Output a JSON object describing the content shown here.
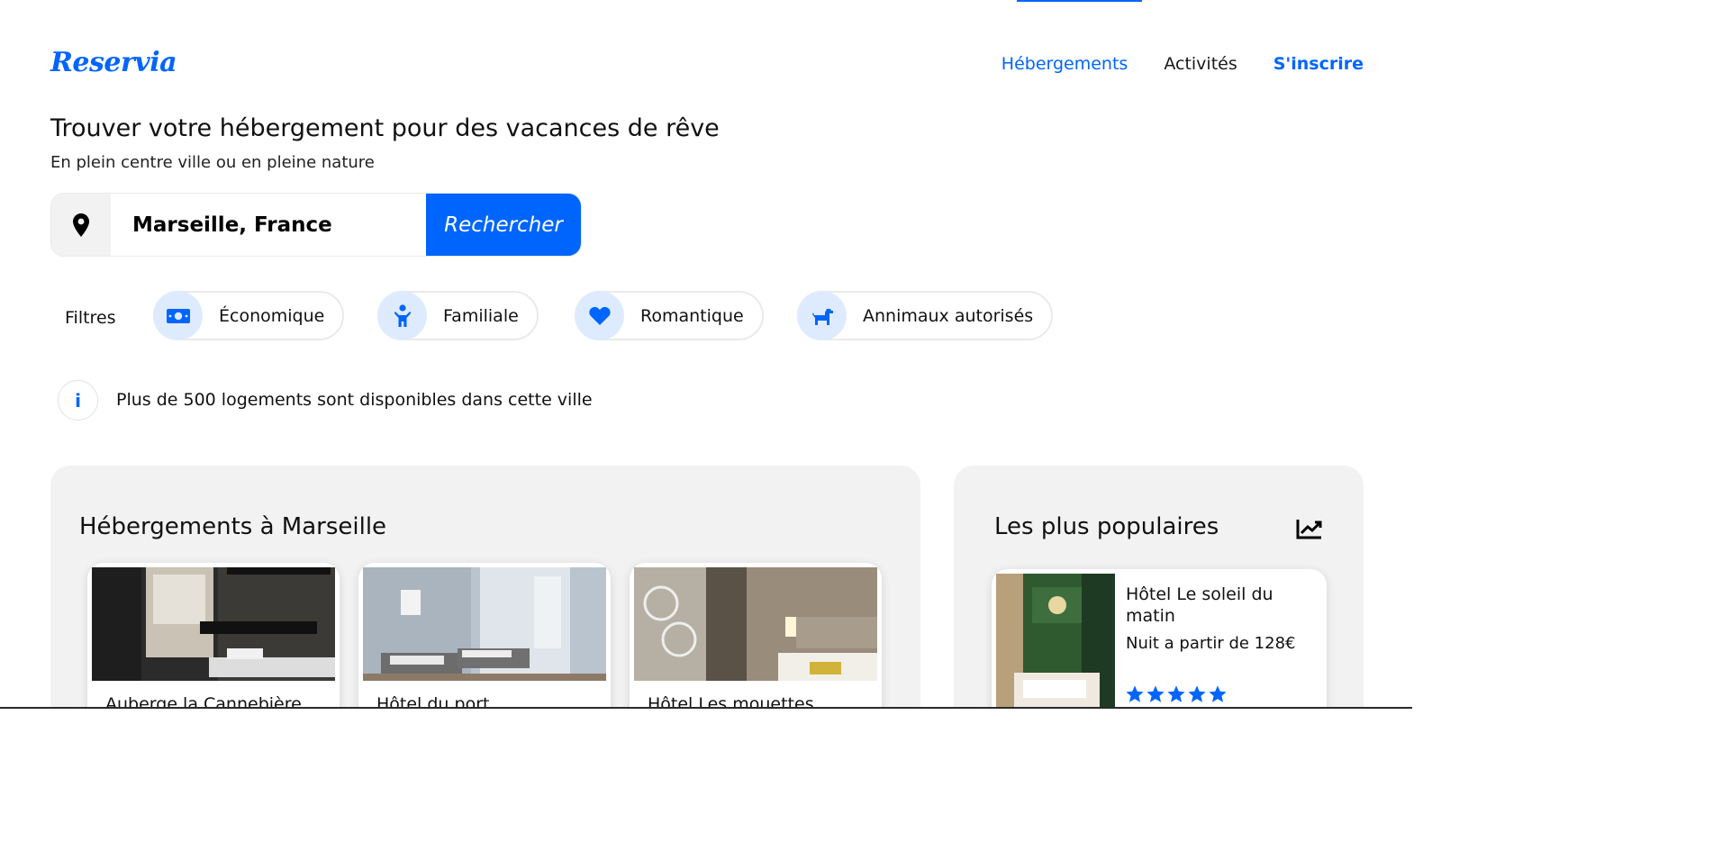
{
  "header": {
    "logo": "Reservia",
    "nav": [
      {
        "label": "Hébergements"
      },
      {
        "label": "Activités"
      },
      {
        "label": "S'inscrire"
      }
    ]
  },
  "hero": {
    "title": "Trouver votre hébergement pour des vacances de rêve",
    "subtitle": "En plein centre ville ou en pleine nature"
  },
  "search": {
    "value": "Marseille, France",
    "button_label": "Rechercher",
    "icon": "location-pin-icon"
  },
  "filters": {
    "label": "Filtres",
    "items": [
      {
        "label": "Économique",
        "icon": "money-bill-icon"
      },
      {
        "label": "Familiale",
        "icon": "child-icon"
      },
      {
        "label": "Romantique",
        "icon": "heart-icon"
      },
      {
        "label": "Annimaux autorisés",
        "icon": "dog-icon"
      }
    ]
  },
  "info": {
    "icon": "info-icon",
    "text": "Plus de 500 logements sont disponibles dans cette ville"
  },
  "hebergements": {
    "title": "Hébergements à Marseille",
    "cards": [
      {
        "title": "Auberge la Cannebière"
      },
      {
        "title": "Hôtel du port"
      },
      {
        "title": "Hôtel Les mouettes"
      }
    ]
  },
  "populaires": {
    "title": "Les plus populaires",
    "icon": "chart-line-icon",
    "cards": [
      {
        "title": "Hôtel Le soleil du matin",
        "price": "Nuit a partir de 128€",
        "rating": 5
      }
    ]
  },
  "colors": {
    "primary": "#0065fc",
    "secondary": "#deebff",
    "panel_bg": "#f2f2f2"
  }
}
